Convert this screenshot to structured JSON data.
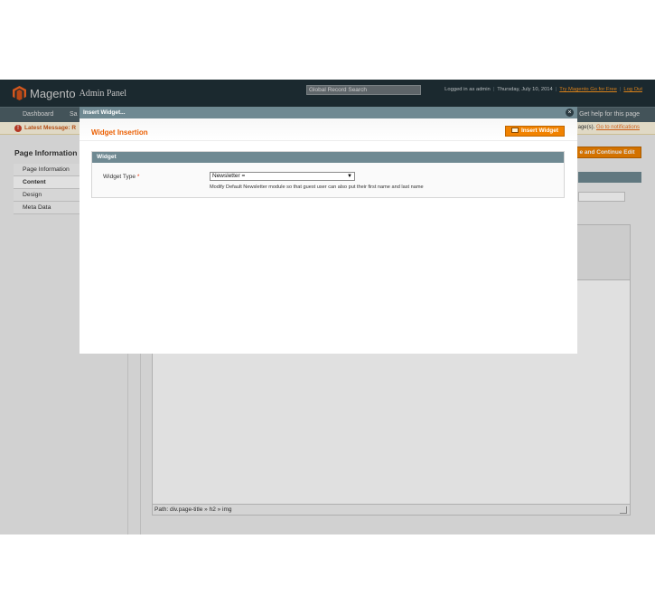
{
  "header": {
    "logo_word": "Magento",
    "logo_sub": "Admin Panel",
    "global_search_placeholder": "Global Record Search",
    "logged_in": "Logged in as admin",
    "date": "Thursday, July 10, 2014",
    "try_link": "Try Magento Go for Free",
    "logout": "Log Out"
  },
  "nav": {
    "items": [
      "Dashboard",
      "Sa"
    ],
    "help": "Get help for this page"
  },
  "message": {
    "label": "Latest Message: R",
    "right_text": "age(s).",
    "right_link": "Go to notifications"
  },
  "sidebar": {
    "title": "Page Information",
    "tabs": [
      "Page Information",
      "Content",
      "Design",
      "Meta Data"
    ]
  },
  "content": {
    "save_continue": "e and Continue Edit",
    "editor_path": "Path: div.page-title » h2 » img"
  },
  "dialog": {
    "title": "Insert Widget...",
    "close": "×",
    "subtitle": "Widget Insertion",
    "insert_button": "Insert Widget",
    "fieldset_title": "Widget",
    "widget_type_label": "Widget Type",
    "required_mark": "*",
    "widget_type_value": "Newsletter =",
    "note": "Modify Default Newsletter module so that guest user can also put their first name and last name"
  },
  "colors": {
    "accent_orange": "#f18200",
    "header_bg": "#1f2f36",
    "dialog_header": "#6f8992"
  }
}
